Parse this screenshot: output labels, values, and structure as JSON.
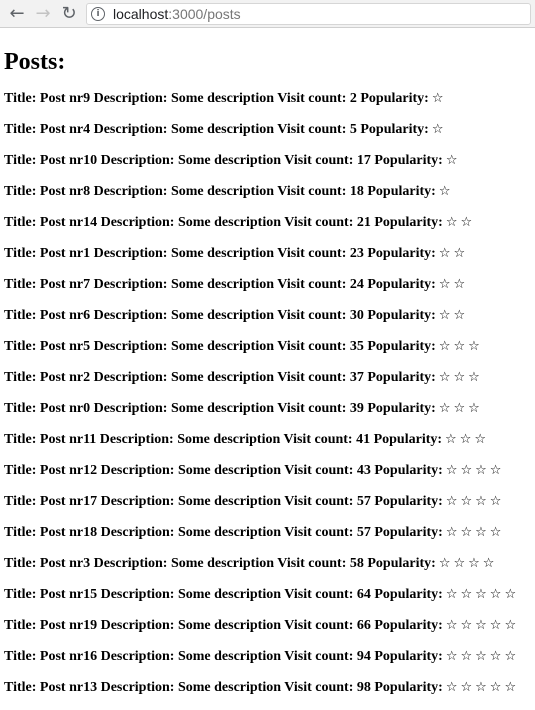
{
  "browser": {
    "back_icon": "back-arrow-icon",
    "forward_icon": "forward-arrow-icon",
    "reload_icon": "reload-icon",
    "info_icon": "info-icon",
    "url_host": "localhost",
    "url_rest": ":3000/posts"
  },
  "page": {
    "heading": "Posts:"
  },
  "labels": {
    "title": "Title:",
    "description": "Description:",
    "visit_count": "Visit count:",
    "popularity": "Popularity:"
  },
  "posts": [
    {
      "title": "Post nr9",
      "description": "Some description",
      "visit_count": 2,
      "popularity": 1
    },
    {
      "title": "Post nr4",
      "description": "Some description",
      "visit_count": 5,
      "popularity": 1
    },
    {
      "title": "Post nr10",
      "description": "Some description",
      "visit_count": 17,
      "popularity": 1
    },
    {
      "title": "Post nr8",
      "description": "Some description",
      "visit_count": 18,
      "popularity": 1
    },
    {
      "title": "Post nr14",
      "description": "Some description",
      "visit_count": 21,
      "popularity": 2
    },
    {
      "title": "Post nr1",
      "description": "Some description",
      "visit_count": 23,
      "popularity": 2
    },
    {
      "title": "Post nr7",
      "description": "Some description",
      "visit_count": 24,
      "popularity": 2
    },
    {
      "title": "Post nr6",
      "description": "Some description",
      "visit_count": 30,
      "popularity": 2
    },
    {
      "title": "Post nr5",
      "description": "Some description",
      "visit_count": 35,
      "popularity": 3
    },
    {
      "title": "Post nr2",
      "description": "Some description",
      "visit_count": 37,
      "popularity": 3
    },
    {
      "title": "Post nr0",
      "description": "Some description",
      "visit_count": 39,
      "popularity": 3
    },
    {
      "title": "Post nr11",
      "description": "Some description",
      "visit_count": 41,
      "popularity": 3
    },
    {
      "title": "Post nr12",
      "description": "Some description",
      "visit_count": 43,
      "popularity": 4
    },
    {
      "title": "Post nr17",
      "description": "Some description",
      "visit_count": 57,
      "popularity": 4
    },
    {
      "title": "Post nr18",
      "description": "Some description",
      "visit_count": 57,
      "popularity": 4
    },
    {
      "title": "Post nr3",
      "description": "Some description",
      "visit_count": 58,
      "popularity": 4
    },
    {
      "title": "Post nr15",
      "description": "Some description",
      "visit_count": 64,
      "popularity": 5
    },
    {
      "title": "Post nr19",
      "description": "Some description",
      "visit_count": 66,
      "popularity": 5
    },
    {
      "title": "Post nr16",
      "description": "Some description",
      "visit_count": 94,
      "popularity": 5
    },
    {
      "title": "Post nr13",
      "description": "Some description",
      "visit_count": 98,
      "popularity": 5
    }
  ],
  "star_glyph": "☆",
  "star_icon": "star-outline-icon"
}
